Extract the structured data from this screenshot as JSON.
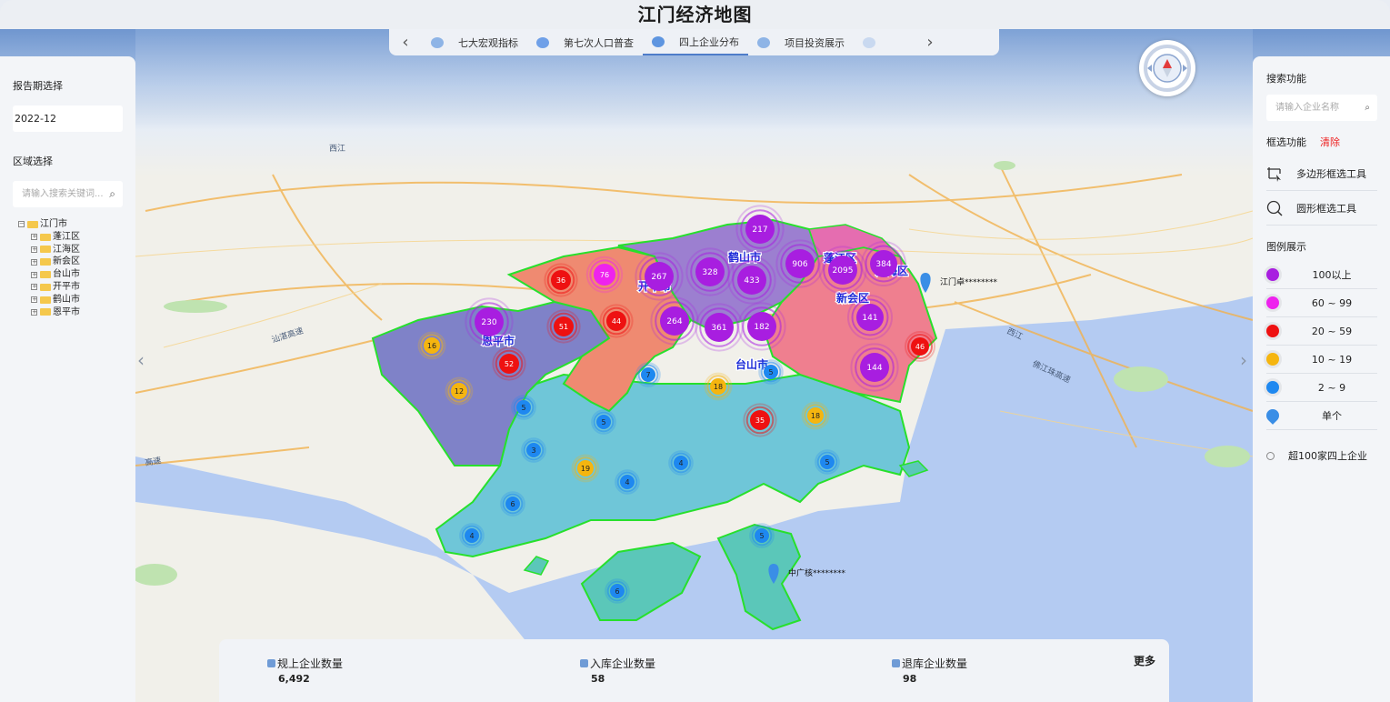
{
  "app": {
    "title": "江门经济地图"
  },
  "tabs": [
    {
      "label": "七大宏观指标",
      "icon": "cloud-icon"
    },
    {
      "label": "第七次人口普查",
      "icon": "person-icon"
    },
    {
      "label": "四上企业分布",
      "icon": "globe-icon",
      "active": true
    },
    {
      "label": "项目投资展示",
      "icon": "magnifier-icon"
    }
  ],
  "left_panel": {
    "period_label": "报告期选择",
    "period_value": "2022-12",
    "region_label": "区域选择",
    "region_placeholder": "请输入搜索关键词...",
    "tree": {
      "root": "江门市",
      "children": [
        "蓬江区",
        "江海区",
        "新会区",
        "台山市",
        "开平市",
        "鹤山市",
        "恩平市"
      ]
    }
  },
  "right_panel": {
    "search_label": "搜索功能",
    "search_placeholder": "请输入企业名称",
    "select_label": "框选功能",
    "clear_label": "清除",
    "tools": [
      {
        "label": "多边形框选工具",
        "icon": "polygon-select-icon"
      },
      {
        "label": "圆形框选工具",
        "icon": "circle-select-icon"
      }
    ],
    "legend_label": "图例展示",
    "legend": [
      {
        "label": "100以上",
        "color": "#a81ee0"
      },
      {
        "label": "60 ~ 99",
        "color": "#ee22ee"
      },
      {
        "label": "20 ~ 59",
        "color": "#ee1111"
      },
      {
        "label": "10 ~ 19",
        "color": "#f5b50f"
      },
      {
        "label": "2 ~ 9",
        "color": "#1e88f0"
      },
      {
        "label": "单个",
        "color": "#3a8ee6"
      }
    ],
    "option_label": "超100家四上企业"
  },
  "map": {
    "region_labels": [
      "蓬江区",
      "江海区",
      "新会区",
      "鹤山市",
      "开平市",
      "恩平市",
      "台山市"
    ],
    "place_labels": [
      "西江",
      "西江",
      "汕湛高速",
      "佛江珠高速",
      "高速"
    ],
    "markers": [
      {
        "label": "江门卓********"
      },
      {
        "label": "中广核********"
      }
    ],
    "clusters": [
      {
        "count": "217",
        "color": "#a81ee0"
      },
      {
        "count": "36",
        "color": "#ee1111"
      },
      {
        "count": "76",
        "color": "#ee22ee"
      },
      {
        "count": "267",
        "color": "#a81ee0"
      },
      {
        "count": "328",
        "color": "#a81ee0"
      },
      {
        "count": "433",
        "color": "#a81ee0"
      },
      {
        "count": "906",
        "color": "#a81ee0"
      },
      {
        "count": "2095",
        "color": "#a81ee0"
      },
      {
        "count": "384",
        "color": "#a81ee0"
      },
      {
        "count": "230",
        "color": "#a81ee0"
      },
      {
        "count": "51",
        "color": "#ee1111"
      },
      {
        "count": "44",
        "color": "#ee1111"
      },
      {
        "count": "264",
        "color": "#a81ee0"
      },
      {
        "count": "361",
        "color": "#a81ee0"
      },
      {
        "count": "182",
        "color": "#a81ee0"
      },
      {
        "count": "141",
        "color": "#a81ee0"
      },
      {
        "count": "46",
        "color": "#ee1111"
      },
      {
        "count": "16",
        "color": "#f5b50f"
      },
      {
        "count": "52",
        "color": "#ee1111"
      },
      {
        "count": "144",
        "color": "#a81ee0"
      },
      {
        "count": "7",
        "color": "#1e88f0"
      },
      {
        "count": "5",
        "color": "#1e88f0"
      },
      {
        "count": "12",
        "color": "#f5b50f"
      },
      {
        "count": "18",
        "color": "#f5b50f"
      },
      {
        "count": "5",
        "color": "#1e88f0"
      },
      {
        "count": "5",
        "color": "#1e88f0"
      },
      {
        "count": "35",
        "color": "#ee1111"
      },
      {
        "count": "18",
        "color": "#f5b50f"
      },
      {
        "count": "3",
        "color": "#1e88f0"
      },
      {
        "count": "19",
        "color": "#f5b50f"
      },
      {
        "count": "4",
        "color": "#1e88f0"
      },
      {
        "count": "4",
        "color": "#1e88f0"
      },
      {
        "count": "5",
        "color": "#1e88f0"
      },
      {
        "count": "6",
        "color": "#1e88f0"
      },
      {
        "count": "4",
        "color": "#1e88f0"
      },
      {
        "count": "5",
        "color": "#1e88f0"
      },
      {
        "count": "6",
        "color": "#1e88f0"
      }
    ]
  },
  "bottom": {
    "stats": [
      {
        "label": "规上企业数量",
        "value": "6,492"
      },
      {
        "label": "入库企业数量",
        "value": "58"
      },
      {
        "label": "退库企业数量",
        "value": "98"
      }
    ],
    "more_label": "更多"
  }
}
